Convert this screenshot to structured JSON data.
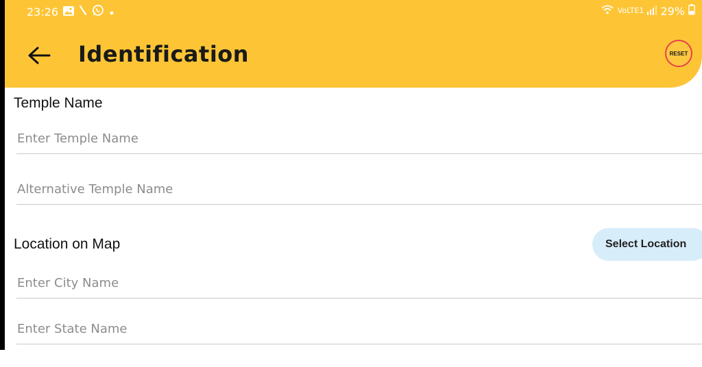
{
  "status_bar": {
    "time": "23:26",
    "network": "VoLTE1",
    "battery": "29%"
  },
  "appbar": {
    "title": "Identification",
    "reset_label": "RESET"
  },
  "form": {
    "temple_section_label": "Temple Name",
    "temple_name_placeholder": "Enter Temple Name",
    "alt_name_placeholder": "Alternative Temple Name",
    "location_section_label": "Location on Map",
    "select_location_label": "Select Location",
    "city_placeholder": "Enter City Name",
    "state_placeholder": "Enter State Name"
  },
  "colors": {
    "header": "#FDC536",
    "reset_ring": "#E8414A",
    "select_location_bg": "#D7EDFA"
  }
}
